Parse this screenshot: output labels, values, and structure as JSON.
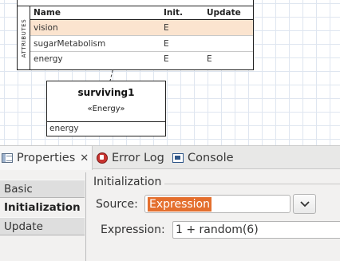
{
  "diagram": {
    "agent_attributes": {
      "section_label": "ATTRIBUTES",
      "columns": [
        "Name",
        "Init.",
        "Update"
      ],
      "rows": [
        {
          "name": "vision",
          "init": "E",
          "update": "",
          "selected": true
        },
        {
          "name": "sugarMetabolism",
          "init": "E",
          "update": "",
          "selected": false
        },
        {
          "name": "energy",
          "init": "E",
          "update": "E",
          "selected": false
        }
      ]
    },
    "state": {
      "title": "surviving1",
      "stereotype": "«Energy»",
      "attribute": "energy"
    }
  },
  "panel": {
    "tabs": [
      {
        "label": "Properties",
        "icon": "properties-icon",
        "active": true,
        "close": "✕"
      },
      {
        "label": "Error Log",
        "icon": "error-log-icon",
        "active": false
      },
      {
        "label": "Console",
        "icon": "console-icon",
        "active": false
      }
    ],
    "side_tabs": [
      {
        "label": "Basic",
        "active": false
      },
      {
        "label": "Initialization",
        "active": true
      },
      {
        "label": "Update",
        "active": false
      }
    ],
    "section_title": "Initialization",
    "source": {
      "label": "Source:",
      "value": "Expression"
    },
    "expression": {
      "label": "Expression:",
      "value": "1 + random(6)"
    }
  },
  "colors": {
    "selected_row": "#fbe4cf",
    "selection_highlight": "#e46f2e",
    "grid": "#dfe6f0"
  }
}
